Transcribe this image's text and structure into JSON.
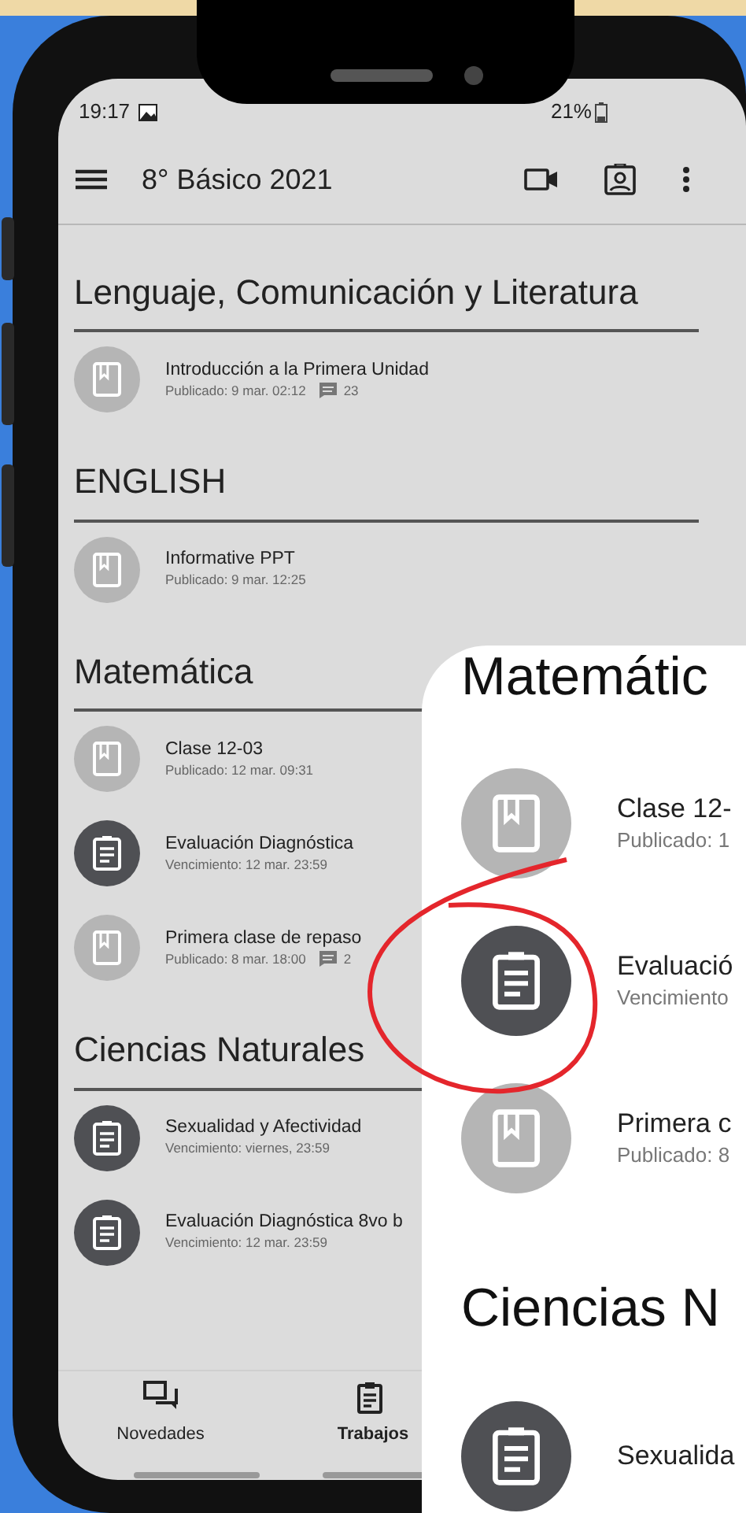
{
  "status_bar": {
    "time": "19:17",
    "battery": "21%"
  },
  "app_bar": {
    "title": "8° Básico 2021"
  },
  "sections": [
    {
      "title": "Lenguaje, Comunicación y Literatura",
      "items": [
        {
          "kind": "material",
          "title": "Introducción a la Primera Unidad",
          "meta": "Publicado: 9 mar. 02:12",
          "comments": "23"
        }
      ]
    },
    {
      "title": "ENGLISH",
      "items": [
        {
          "kind": "material",
          "title": "Informative PPT",
          "meta": "Publicado: 9 mar. 12:25"
        }
      ]
    },
    {
      "title": "Matemática",
      "items": [
        {
          "kind": "material",
          "title": "Clase 12-03",
          "meta": "Publicado: 12 mar. 09:31"
        },
        {
          "kind": "assignment",
          "title": "Evaluación Diagnóstica",
          "meta": "Vencimiento: 12 mar. 23:59"
        },
        {
          "kind": "material",
          "title": "Primera clase de repaso",
          "meta": "Publicado: 8 mar. 18:00",
          "comments": "2"
        }
      ]
    },
    {
      "title": "Ciencias Naturales",
      "items": [
        {
          "kind": "assignment",
          "title": "Sexualidad y Afectividad",
          "meta": "Vencimiento: viernes, 23:59"
        },
        {
          "kind": "assignment",
          "title": "Evaluación Diagnóstica 8vo b",
          "meta": "Vencimiento: 12 mar. 23:59"
        }
      ]
    }
  ],
  "bottom_nav": [
    {
      "label": "Novedades",
      "kind": "stream",
      "selected": false
    },
    {
      "label": "Trabajos",
      "kind": "classwork",
      "selected": true
    }
  ],
  "zoom_inset": {
    "sections": [
      {
        "title": "Matemátic",
        "items": [
          {
            "kind": "material",
            "title": "Clase 12-",
            "meta": "Publicado: 1"
          },
          {
            "kind": "assignment",
            "title": "Evaluació",
            "meta": "Vencimiento"
          },
          {
            "kind": "material",
            "title": "Primera c",
            "meta": "Publicado: 8"
          }
        ]
      },
      {
        "title": "Ciencias N",
        "items": [
          {
            "kind": "assignment",
            "title": "Sexualida"
          }
        ]
      }
    ]
  }
}
